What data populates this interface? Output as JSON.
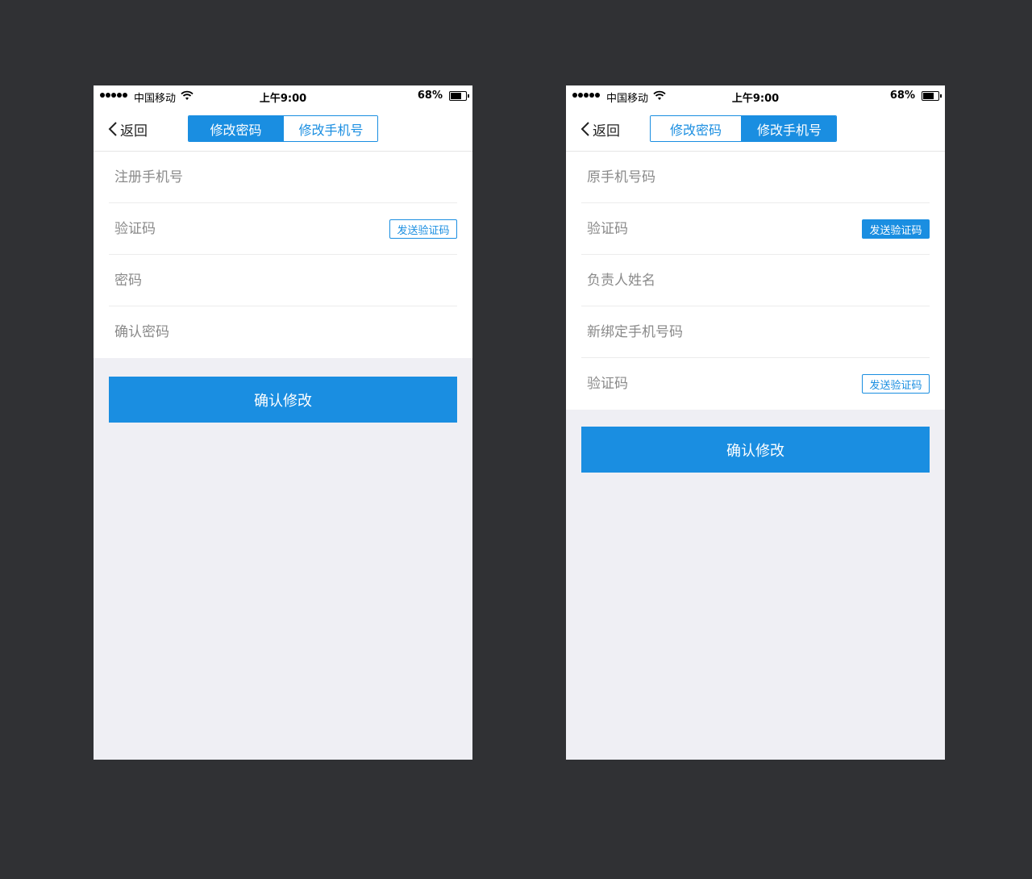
{
  "status": {
    "carrier": "中国移动",
    "time": "上午9:00",
    "battery": "68%"
  },
  "nav": {
    "back_label": "返回",
    "tab_password": "修改密码",
    "tab_phone": "修改手机号"
  },
  "left": {
    "active_tab": "修改密码",
    "fields": {
      "phone": "注册手机号",
      "code": "验证码",
      "password": "密码",
      "confirm": "确认密码"
    },
    "send_code": "发送验证码",
    "submit": "确认修改"
  },
  "right": {
    "active_tab": "修改手机号",
    "fields": {
      "old_phone": "原手机号码",
      "code1": "验证码",
      "owner_name": "负责人姓名",
      "new_phone": "新绑定手机号码",
      "code2": "验证码"
    },
    "send_code_1": "发送验证码",
    "send_code_2": "发送验证码",
    "submit": "确认修改"
  },
  "colors": {
    "accent": "#1a8ee1",
    "canvas": "#303134",
    "page_bg": "#efeff4"
  },
  "icons": {
    "back": "chevron-left-icon",
    "wifi": "wifi-icon",
    "battery": "battery-icon",
    "signal": "signal-dots-icon"
  }
}
